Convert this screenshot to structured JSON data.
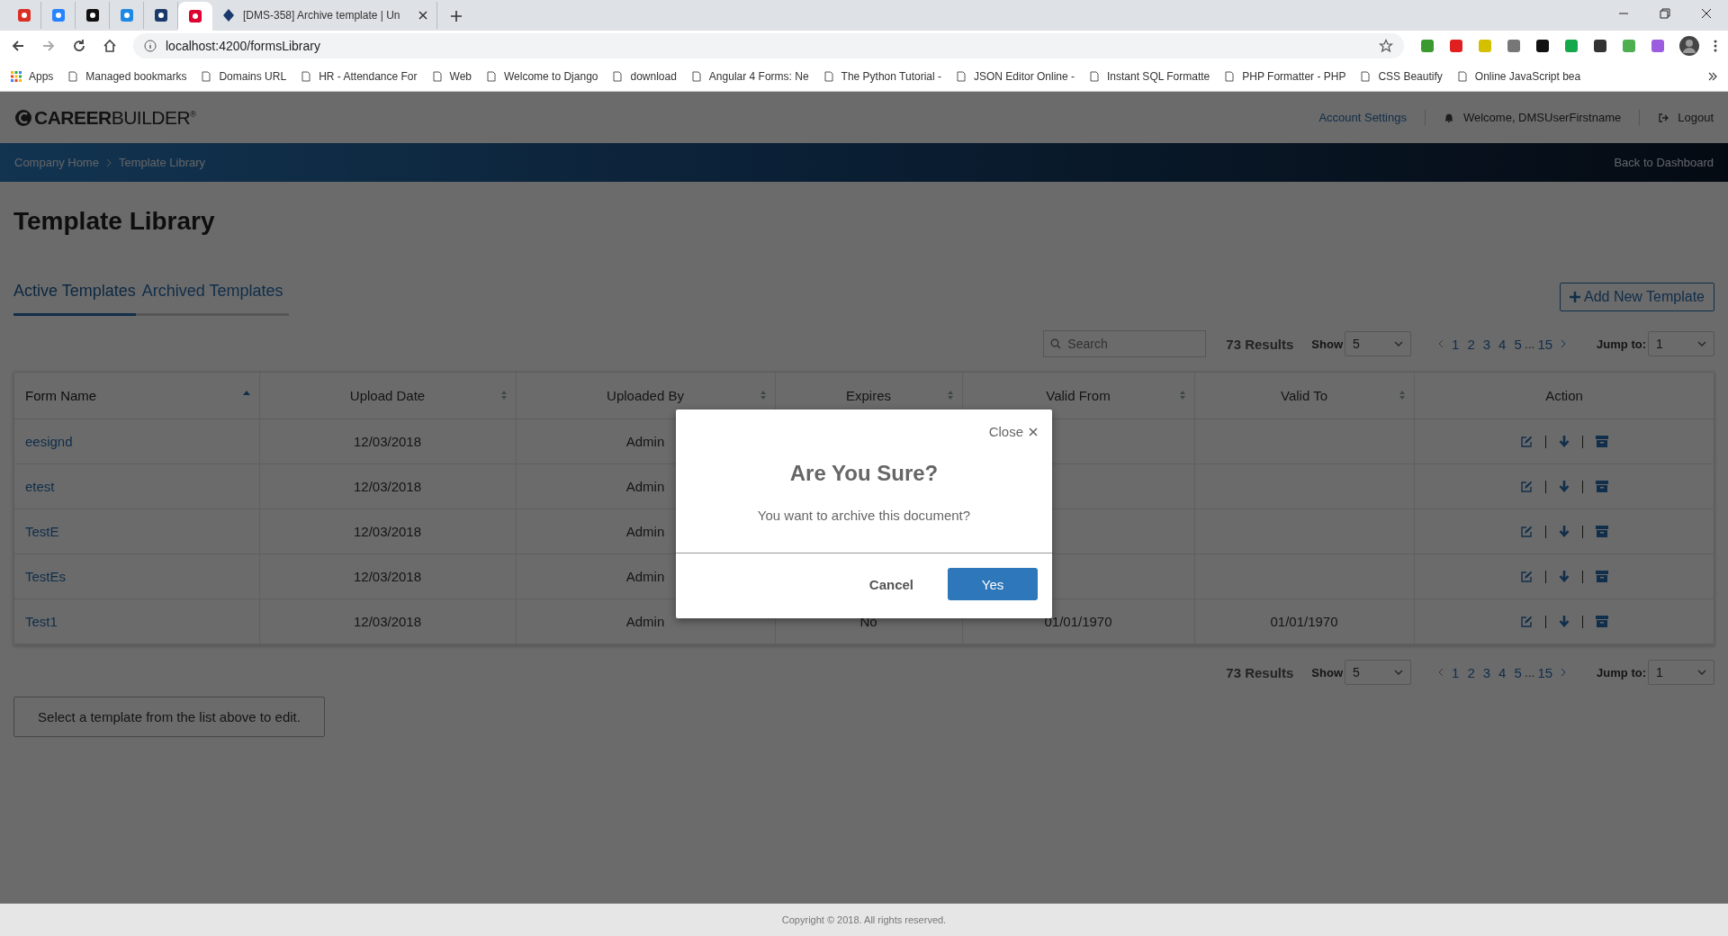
{
  "browser": {
    "tabs": [
      {
        "kind": "pinned",
        "selected": false
      },
      {
        "kind": "pinned",
        "selected": false
      },
      {
        "kind": "pinned",
        "selected": false
      },
      {
        "kind": "pinned",
        "selected": false
      },
      {
        "kind": "pinned",
        "selected": false
      },
      {
        "kind": "pinned",
        "selected": true
      },
      {
        "kind": "full",
        "title": "[DMS-358] Archive template | Un",
        "selected": false
      }
    ],
    "address": "localhost:4200/formsLibrary",
    "bookmarks": [
      "Apps",
      "Managed bookmarks",
      "Domains URL",
      "HR - Attendance For",
      "Web",
      "Welcome to Django",
      "download",
      "Angular 4 Forms: Ne",
      "The Python Tutorial -",
      "JSON Editor Online -",
      "Instant SQL Formatte",
      "PHP Formatter - PHP",
      "CSS Beautify",
      "Online JavaScript bea"
    ]
  },
  "header": {
    "logo": "**CAREER**BUILDER$^{®}$",
    "nav": [
      "Account Settings",
      "Welcome, DMSUserFirstname",
      "Logout"
    ]
  },
  "breadcrumb": {
    "items": [
      "Company Home",
      "Template Library"
    ],
    "back": "Back to Dashboard"
  },
  "title": "Template Library",
  "tabs": [
    {
      "label": "Active Templates",
      "selected": true
    },
    {
      "label": "Archived Templates",
      "selected": false
    }
  ],
  "add_button": "Add New Template",
  "search": {
    "placeholder": "Search"
  },
  "paginations": [
    {
      "results": "73 Results",
      "show_label": "Show",
      "show_value": "5",
      "pages": [
        "1",
        "2",
        "3",
        "4",
        "5"
      ],
      "ellipsis": "...",
      "last": "15",
      "jump_label": "Jump to:",
      "jump_value": "1"
    },
    {
      "results": "73 Results",
      "show_label": "Show",
      "show_value": "5",
      "pages": [
        "1",
        "2",
        "3",
        "4",
        "5"
      ],
      "ellipsis": "...",
      "last": "15",
      "jump_label": "Jump to:",
      "jump_value": "1"
    }
  ],
  "table": {
    "columns": [
      {
        "label": "Form Name",
        "sortable": true,
        "sorted": true
      },
      {
        "label": "Upload Date",
        "sortable": true,
        "sorted": false
      },
      {
        "label": "Uploaded By",
        "sortable": true,
        "sorted": false
      },
      {
        "label": "Expires",
        "sortable": true,
        "sorted": false
      },
      {
        "label": "Valid From",
        "sortable": true,
        "sorted": false
      },
      {
        "label": "Valid To",
        "sortable": true,
        "sorted": false
      },
      {
        "label": "Action",
        "sortable": false
      }
    ],
    "rows": [
      {
        "form_name": "eesignd",
        "upload_date": "12/03/2018",
        "uploaded_by": "Admin"
      },
      {
        "form_name": "etest",
        "upload_date": "12/03/2018",
        "uploaded_by": "Admin"
      },
      {
        "form_name": "TestE",
        "upload_date": "12/03/2018",
        "uploaded_by": "Admin"
      },
      {
        "form_name": "TestEs",
        "upload_date": "12/03/2018",
        "uploaded_by": "Admin"
      },
      {
        "form_name": "Test1",
        "upload_date": "12/03/2018",
        "uploaded_by": "Admin",
        "expires": "No",
        "valid_from": "01/01/1970",
        "valid_to": "01/01/1970"
      }
    ]
  },
  "hint": "Select a template from the list above to edit.",
  "modal": {
    "close": "Close",
    "title": "Are You Sure?",
    "message": "You want to archive this document?",
    "cancel": "Cancel",
    "confirm": "Yes"
  },
  "footer": "Copyright © 2018. All rights reserved."
}
